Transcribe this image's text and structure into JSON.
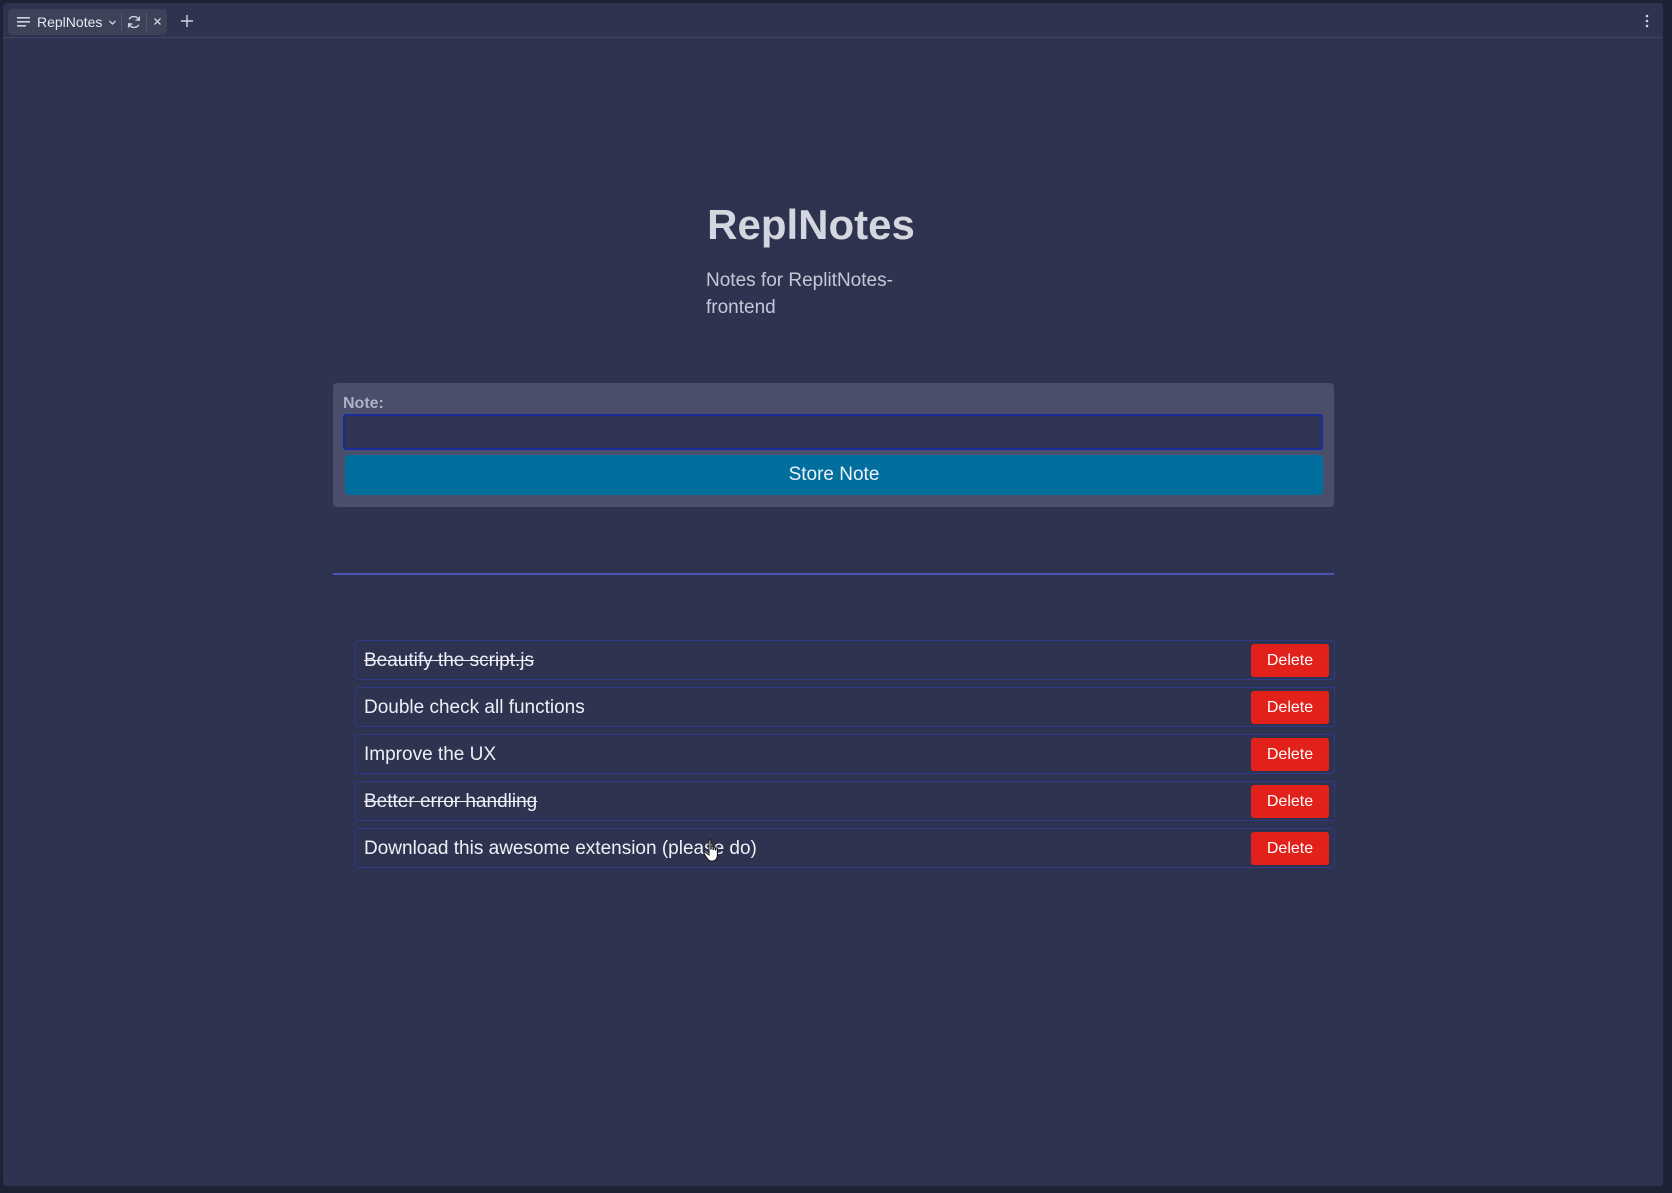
{
  "browser": {
    "tab_title": "ReplNotes",
    "icons": [
      "doc-icon",
      "chevron-down-icon",
      "reload-icon",
      "close-icon",
      "plus-icon",
      "kebab-menu-icon"
    ]
  },
  "page": {
    "title": "ReplNotes",
    "subtitle": "Notes for ReplitNotes-frontend",
    "form": {
      "label": "Note:",
      "input_value": "",
      "button_label": "Store Note"
    },
    "notes": [
      {
        "text": "Beautify the script.js",
        "done": true,
        "delete_label": "Delete"
      },
      {
        "text": "Double check all functions",
        "done": false,
        "delete_label": "Delete"
      },
      {
        "text": "Improve the UX",
        "done": false,
        "delete_label": "Delete"
      },
      {
        "text": "Better error handling",
        "done": true,
        "delete_label": "Delete"
      },
      {
        "text": "Download this awesome extension (please do)",
        "done": false,
        "delete_label": "Delete"
      }
    ]
  },
  "colors": {
    "background": "#2e3350",
    "card": "#4a4e6b",
    "primary_button": "#006f9e",
    "delete_button": "#e3211b",
    "divider": "#4a55b8"
  }
}
